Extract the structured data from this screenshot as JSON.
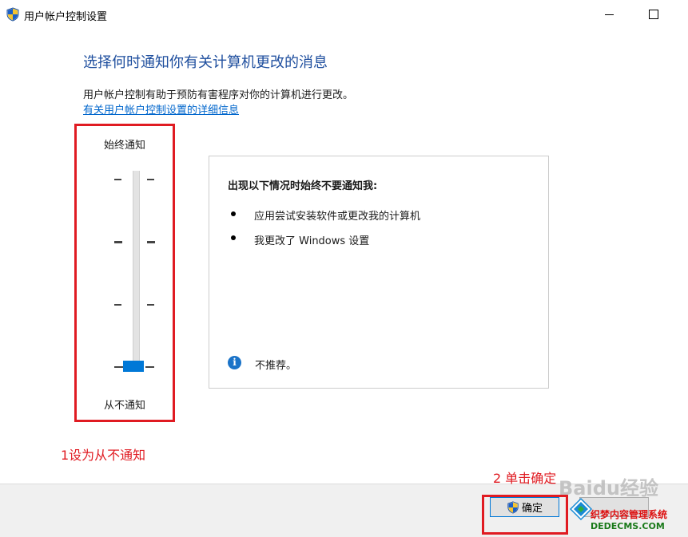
{
  "window": {
    "title": "用户帐户控制设置"
  },
  "main": {
    "heading": "选择何时通知你有关计算机更改的消息",
    "description": "用户帐户控制有助于预防有害程序对你的计算机进行更改。",
    "link": "有关用户帐户控制设置的详细信息"
  },
  "slider": {
    "top_label": "始终通知",
    "bottom_label": "从不通知",
    "levels": 4,
    "selected_level": 0
  },
  "info_panel": {
    "title": "出现以下情况时始终不要通知我:",
    "bullets": [
      "应用尝试安装软件或更改我的计算机",
      "我更改了 Windows 设置"
    ],
    "recommendation": "不推荐。"
  },
  "annotations": {
    "step1": "1设为从不通知",
    "step2": "2 单击确定"
  },
  "footer": {
    "ok_label": "确定"
  },
  "watermark": {
    "line1": "Baidu经验",
    "line2": "织梦内容管理系统",
    "line3": "DEDECMS.COM"
  },
  "colors": {
    "accent": "#0078d7",
    "annotation": "#e01b22",
    "heading": "#1e4e9e",
    "link": "#0066cc"
  },
  "icons": {
    "window": "uac-shield-icon",
    "info": "info-icon",
    "ok": "uac-shield-icon"
  }
}
